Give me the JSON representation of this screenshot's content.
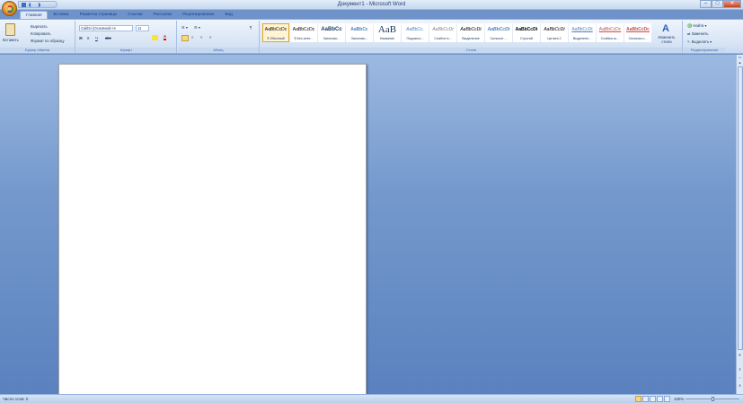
{
  "window": {
    "title": "Документ1 - Microsoft Word"
  },
  "tabs": [
    "Главная",
    "Вставка",
    "Разметка страницы",
    "Ссылки",
    "Рассылки",
    "Рецензирование",
    "Вид"
  ],
  "clipboard": {
    "paste": "Вставить",
    "cut": "Вырезать",
    "copy": "Копировать",
    "format_painter": "Формат по образцу",
    "label": "Буфер обмена"
  },
  "font": {
    "name": "Calibri (Основной те",
    "size": "11",
    "label": "Шрифт"
  },
  "paragraph": {
    "label": "Абзац"
  },
  "styles": {
    "label": "Стили",
    "items": [
      {
        "preview": "AaBbCcDc",
        "name": "¶ Обычный"
      },
      {
        "preview": "AaBbCcDc",
        "name": "¶ Без инте..."
      },
      {
        "preview": "AaBbCc",
        "name": "Заголово..."
      },
      {
        "preview": "AaBbCc",
        "name": "Заголово..."
      },
      {
        "preview": "AaB",
        "name": "Название"
      },
      {
        "preview": "AaBbCc.",
        "name": "Подзагол..."
      },
      {
        "preview": "AaBbCcDt",
        "name": "Слабое в..."
      },
      {
        "preview": "AaBbCcDt",
        "name": "Выделение"
      },
      {
        "preview": "AaBbCcDt",
        "name": "Сильное ..."
      },
      {
        "preview": "AaBbCcDt",
        "name": "Строгий"
      },
      {
        "preview": "AaBbCcDt",
        "name": "Цитата 2"
      },
      {
        "preview": "AaBbCcDt",
        "name": "Выделенн..."
      },
      {
        "preview": "AaBbCcDc",
        "name": "Слабая сс..."
      },
      {
        "preview": "AaBbCcDc",
        "name": "Сильная с..."
      }
    ],
    "change": "Изменить стили"
  },
  "editing": {
    "find": "Найти",
    "replace": "Заменить",
    "select": "Выделить",
    "label": "Редактирование"
  },
  "status": {
    "words": "Число слов: 0",
    "zoom": "100%"
  }
}
